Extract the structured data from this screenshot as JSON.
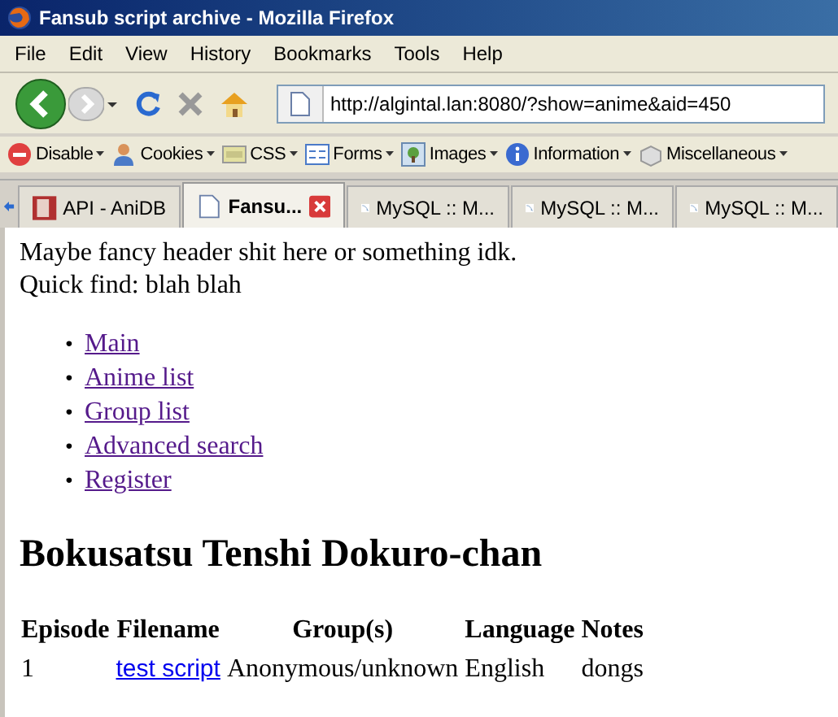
{
  "window": {
    "title": "Fansub script archive - Mozilla Firefox"
  },
  "menu": [
    "File",
    "Edit",
    "View",
    "History",
    "Bookmarks",
    "Tools",
    "Help"
  ],
  "address_bar": {
    "value": "http://algintal.lan:8080/?show=anime&aid=450"
  },
  "toolbar": [
    {
      "kind": "disable",
      "label": "Disable"
    },
    {
      "kind": "cookies",
      "label": "Cookies"
    },
    {
      "kind": "css",
      "label": "CSS"
    },
    {
      "kind": "forms",
      "label": "Forms"
    },
    {
      "kind": "images",
      "label": "Images"
    },
    {
      "kind": "information",
      "label": "Information"
    },
    {
      "kind": "misc",
      "label": "Miscellaneous"
    }
  ],
  "tabs": [
    {
      "kind": "anidb",
      "label": "API - AniDB",
      "selected": false
    },
    {
      "kind": "page",
      "label": "Fansu...",
      "selected": true
    },
    {
      "kind": "mysql",
      "label": "MySQL :: M...",
      "selected": false
    },
    {
      "kind": "mysql",
      "label": "MySQL :: M...",
      "selected": false
    },
    {
      "kind": "mysql",
      "label": "MySQL :: M...",
      "selected": false
    }
  ],
  "page": {
    "header": "Maybe fancy header shit here or something idk.",
    "quick_find": "Quick find: blah blah",
    "nav_links": [
      {
        "marker": "•",
        "label": "Main",
        "visited": true
      },
      {
        "marker": "•",
        "label": "Anime list",
        "visited": true
      },
      {
        "marker": "•",
        "label": "Group list",
        "visited": true
      },
      {
        "marker": "•",
        "label": "Advanced search",
        "visited": true
      },
      {
        "marker": "•",
        "label": "Register",
        "visited": true
      }
    ],
    "title": "Bokusatsu Tenshi Dokuro-chan",
    "table": {
      "columns": [
        "Episode",
        "Filename",
        "Group(s)",
        "Language",
        "Notes"
      ],
      "rows": [
        [
          {
            "kind": "text",
            "text": "1"
          },
          {
            "kind": "link",
            "text": "test script",
            "visited": false
          },
          {
            "kind": "text",
            "text": "Anonymous/unknown"
          },
          {
            "kind": "text",
            "text": "English"
          },
          {
            "kind": "text",
            "text": "dongs"
          }
        ]
      ]
    }
  }
}
